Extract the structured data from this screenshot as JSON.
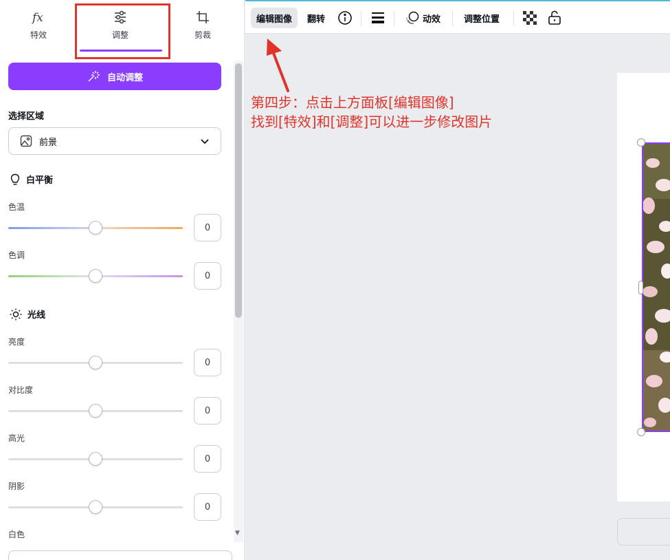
{
  "tabs": [
    {
      "label": "特效",
      "icon": "fx-icon"
    },
    {
      "label": "调整",
      "icon": "sliders-icon"
    },
    {
      "label": "剪裁",
      "icon": "crop-icon"
    }
  ],
  "auto_adjust_label": "自动调整",
  "select_area": {
    "label": "选择区域",
    "value": "前景"
  },
  "white_balance": {
    "title": "白平衡",
    "sliders": [
      {
        "label": "色温",
        "value": "0",
        "position": 0.5
      },
      {
        "label": "色调",
        "value": "0",
        "position": 0.5
      }
    ]
  },
  "light": {
    "title": "光线",
    "sliders": [
      {
        "label": "亮度",
        "value": "0",
        "position": 0.5
      },
      {
        "label": "对比度",
        "value": "0",
        "position": 0.5
      },
      {
        "label": "高光",
        "value": "0",
        "position": 0.5
      },
      {
        "label": "阴影",
        "value": "0",
        "position": 0.5
      }
    ],
    "next_label": "白色"
  },
  "toolbar": {
    "edit_image": "编辑图像",
    "flip": "翻转",
    "animate": "动效",
    "position": "调整位置"
  },
  "annotation": {
    "line1": "第四步：点击上方面板[编辑图像]",
    "line2": "找到[特效]和[调整]可以进一步修改图片"
  },
  "colors": {
    "accent": "#8b3dff",
    "annotation_red": "#e0342a"
  }
}
